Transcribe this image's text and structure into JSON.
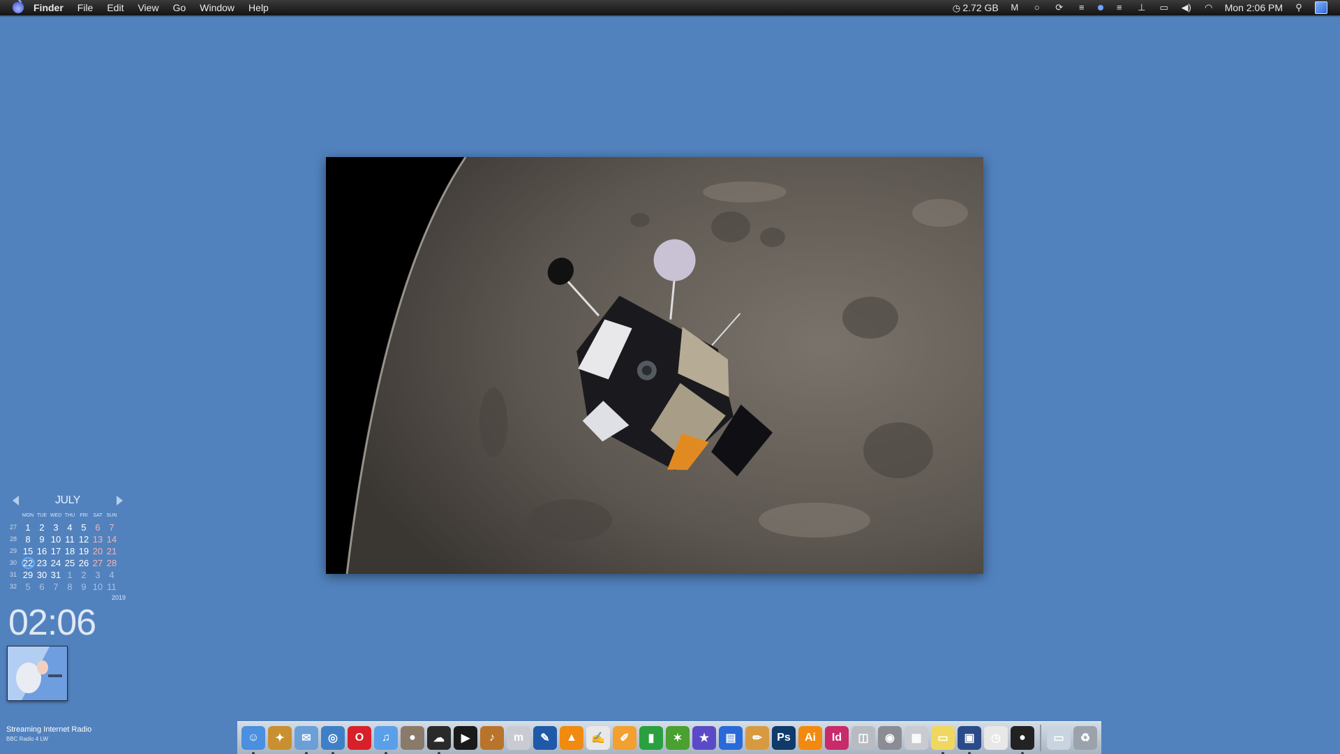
{
  "menubar": {
    "app_name": "Finder",
    "menus": [
      "File",
      "Edit",
      "View",
      "Go",
      "Window",
      "Help"
    ],
    "memory": "2.72 GB",
    "clock": "Mon 2:06 PM",
    "icons": [
      "timemachine-icon",
      "malwarebytes-icon",
      "circle-icon",
      "sync-icon",
      "equals-icon",
      "blue-dot-icon",
      "equals-icon",
      "network-icon",
      "airplay-icon",
      "volume-icon",
      "wifi-icon",
      "spotlight-icon",
      "notification-icon"
    ]
  },
  "calendar": {
    "month": "JULY",
    "year": "2019",
    "dow": [
      "MON",
      "TUE",
      "WED",
      "THU",
      "FRI",
      "SAT",
      "SUN"
    ],
    "weeks": [
      {
        "num": "27",
        "days": [
          "1",
          "2",
          "3",
          "4",
          "5",
          "6",
          "7"
        ]
      },
      {
        "num": "28",
        "days": [
          "8",
          "9",
          "10",
          "11",
          "12",
          "13",
          "14"
        ]
      },
      {
        "num": "29",
        "days": [
          "15",
          "16",
          "17",
          "18",
          "19",
          "20",
          "21"
        ]
      },
      {
        "num": "30",
        "days": [
          "22",
          "23",
          "24",
          "25",
          "26",
          "27",
          "28"
        ]
      },
      {
        "num": "31",
        "days": [
          "29",
          "30",
          "31",
          "1",
          "2",
          "3",
          "4"
        ]
      },
      {
        "num": "32",
        "days": [
          "5",
          "6",
          "7",
          "8",
          "9",
          "10",
          "11"
        ]
      }
    ],
    "today": "22"
  },
  "clock_widget": {
    "time": "02:06"
  },
  "radio_widget": {
    "title": "Streaming Internet Radio",
    "station": "BBC Radio 4 LW"
  },
  "dock": {
    "items": [
      {
        "name": "finder-icon",
        "glyph": "☺",
        "color": "#4a8fe0",
        "running": true
      },
      {
        "name": "app-store-box-icon",
        "glyph": "✦",
        "color": "#c89030",
        "running": false
      },
      {
        "name": "mail-icon",
        "glyph": "✉",
        "color": "#6a9fd8",
        "running": true
      },
      {
        "name": "safari-icon",
        "glyph": "◎",
        "color": "#3f7fc8",
        "running": true
      },
      {
        "name": "opera-icon",
        "glyph": "O",
        "color": "#d8202a",
        "running": false
      },
      {
        "name": "itunes-icon",
        "glyph": "♫",
        "color": "#5aa0e8",
        "running": true
      },
      {
        "name": "planet-icon",
        "glyph": "●",
        "color": "#8a7a6a",
        "running": false
      },
      {
        "name": "cloud-icon",
        "glyph": "☁",
        "color": "#2a2a2a",
        "running": true
      },
      {
        "name": "terminal-icon",
        "glyph": "▶",
        "color": "#1a1a1a",
        "running": false
      },
      {
        "name": "garageband-icon",
        "glyph": "♪",
        "color": "#b8742a",
        "running": false
      },
      {
        "name": "musescore-icon",
        "glyph": "m",
        "color": "#c8ccd2",
        "running": false
      },
      {
        "name": "pen-icon",
        "glyph": "✎",
        "color": "#1e5aa8",
        "running": false
      },
      {
        "name": "vlc-icon",
        "glyph": "▲",
        "color": "#f08a10",
        "running": false
      },
      {
        "name": "textedit-icon",
        "glyph": "✍",
        "color": "#e8e8e8",
        "running": false
      },
      {
        "name": "pages-icon",
        "glyph": "✐",
        "color": "#f2a030",
        "running": false
      },
      {
        "name": "numbers-icon",
        "glyph": "▮",
        "color": "#2aa040",
        "running": false
      },
      {
        "name": "network-tool-icon",
        "glyph": "✶",
        "color": "#4aa030",
        "running": false
      },
      {
        "name": "imovie-icon",
        "glyph": "★",
        "color": "#5a4ac8",
        "running": false
      },
      {
        "name": "document-icon",
        "glyph": "▤",
        "color": "#2a6ad8",
        "running": false
      },
      {
        "name": "script-editor-icon",
        "glyph": "✏",
        "color": "#d89a40",
        "running": false
      },
      {
        "name": "photoshop-icon",
        "glyph": "Ps",
        "color": "#0f3a6a",
        "running": false
      },
      {
        "name": "illustrator-icon",
        "glyph": "Ai",
        "color": "#f28a10",
        "running": false
      },
      {
        "name": "indesign-icon",
        "glyph": "Id",
        "color": "#c82a6a",
        "running": false
      },
      {
        "name": "system-info-icon",
        "glyph": "◫",
        "color": "#b8bcc2",
        "running": false
      },
      {
        "name": "disk-utility-icon",
        "glyph": "◉",
        "color": "#8a8e94",
        "running": false
      },
      {
        "name": "calculator-icon",
        "glyph": "▦",
        "color": "#c8ccd0",
        "running": false
      },
      {
        "name": "stickies-icon",
        "glyph": "▭",
        "color": "#f0d860",
        "running": true
      },
      {
        "name": "window-manager-icon",
        "glyph": "▣",
        "color": "#2a4a8a",
        "running": true
      },
      {
        "name": "clock-icon",
        "glyph": "◷",
        "color": "#e8e8e8",
        "running": false
      },
      {
        "name": "alfred-icon",
        "glyph": "●",
        "color": "#222222",
        "running": true
      },
      {
        "name": "downloads-folder-icon",
        "glyph": "▭",
        "color": "#c8d4e0",
        "running": false,
        "after_separator": true
      },
      {
        "name": "trash-icon",
        "glyph": "♻",
        "color": "#9aa2ac",
        "running": false
      }
    ]
  }
}
